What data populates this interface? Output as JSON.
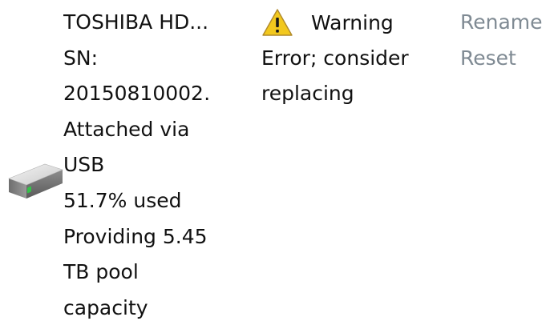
{
  "drive": {
    "name": "TOSHIBA HD...",
    "serial_label": "SN:",
    "serial_value": "20150810002․",
    "attached_line1": "Attached via",
    "attached_line2": "USB",
    "usage": "51.7% used",
    "capacity_line1": "Providing 5.45",
    "capacity_line2": "TB pool",
    "capacity_line3": "capacity",
    "icon": "hard-drive-icon"
  },
  "status": {
    "icon": "warning-icon",
    "title": "Warning",
    "description": "Error; consider replacing"
  },
  "actions": {
    "rename_label": "Rename",
    "reset_label": "Reset"
  },
  "colors": {
    "text": "#111111",
    "link": "#7f8a93",
    "warning_fill": "#f2c81e",
    "drive_led": "#35c24a"
  }
}
